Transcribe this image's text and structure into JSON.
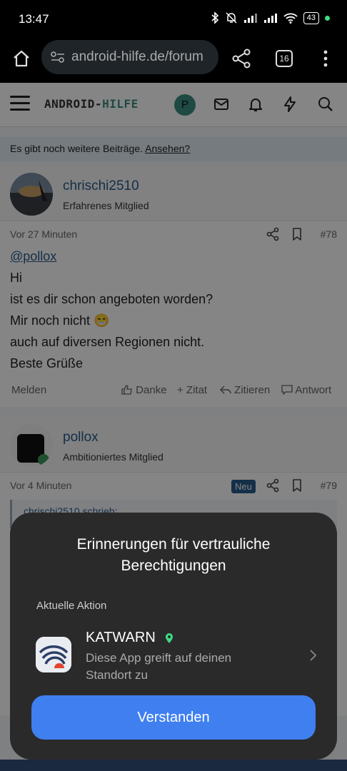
{
  "status_bar": {
    "time": "13:47",
    "battery": "43"
  },
  "browser": {
    "url": "android-hilfe.de/forum",
    "tab_count": "16"
  },
  "site": {
    "logo_left": "ANDROID-",
    "logo_right": "HILFE",
    "user_initial": "P",
    "notice_text": "Es gibt noch weitere Beiträge.",
    "notice_link": "Ansehen?"
  },
  "posts": [
    {
      "author": "chrischi2510",
      "rank": "Erfahrenes Mitglied",
      "time": "Vor 27 Minuten",
      "number": "#78",
      "lines": [
        "@pollox",
        "Hi",
        "ist es dir schon angeboten worden?",
        "Mir noch nicht 😁",
        "auch auf diversen Regionen nicht.",
        "Beste Grüße"
      ],
      "actions": {
        "report": "Melden",
        "like": "Danke",
        "quote": "+ Zitat",
        "reply_quote": "Zitieren",
        "reply": "Antwort"
      }
    },
    {
      "author": "pollox",
      "rank": "Ambitioniertes Mitglied",
      "time": "Vor 4 Minuten",
      "badge": "Neu",
      "number": "#79",
      "quote_header": "chrischi2510 schrieb:"
    }
  ],
  "dialog": {
    "title": "Erinnerungen für vertrauliche Berechtigungen",
    "subtitle": "Aktuelle Aktion",
    "app_name": "KATWARN",
    "app_desc": "Diese App greift auf deinen Standort zu",
    "confirm": "Verstanden"
  }
}
